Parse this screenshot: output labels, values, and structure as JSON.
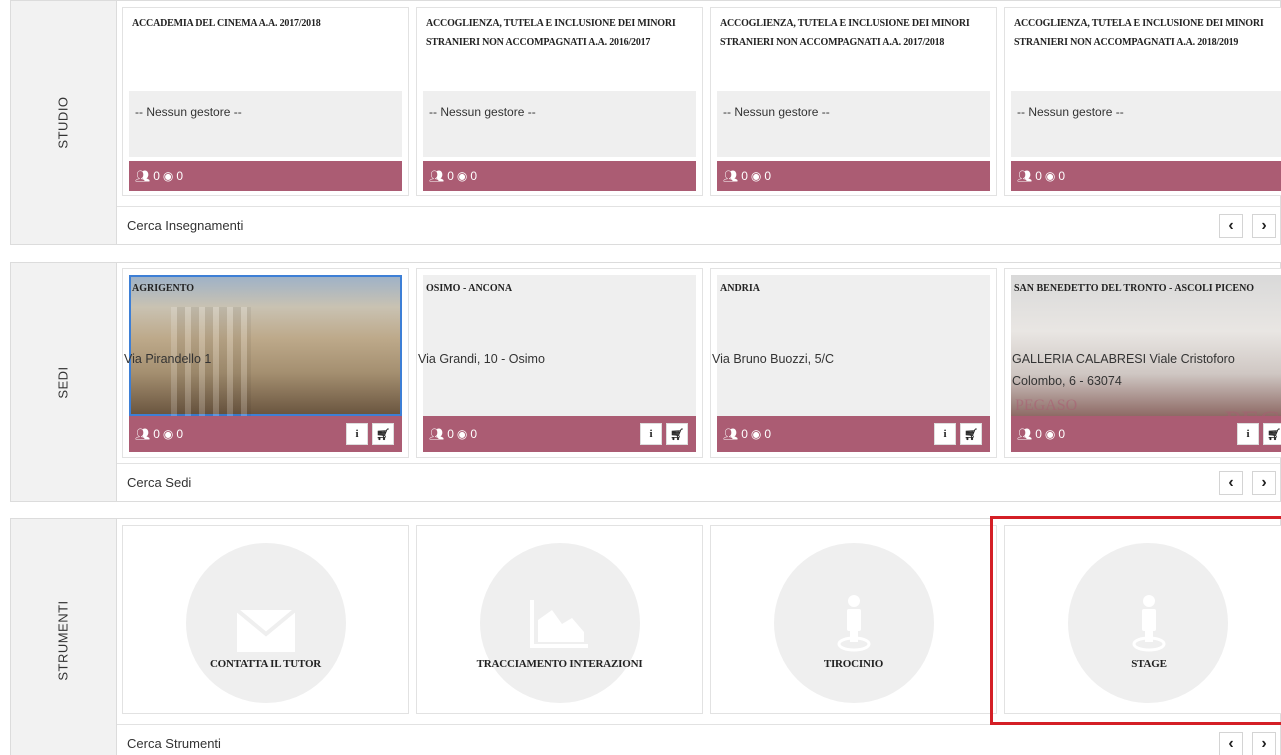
{
  "studio": {
    "label": "STUDIO",
    "cards": [
      {
        "title": "ACCADEMIA DEL CINEMA A.A. 2017/2018",
        "gestore": "-- Nessun gestore --",
        "groups": "0",
        "users": "0"
      },
      {
        "title": "ACCOGLIENZA, TUTELA E INCLUSIONE DEI MINORI STRANIERI NON ACCOMPAGNATI A.A. 2016/2017",
        "gestore": "-- Nessun gestore --",
        "groups": "0",
        "users": "0"
      },
      {
        "title": "ACCOGLIENZA, TUTELA E INCLUSIONE DEI MINORI STRANIERI NON ACCOMPAGNATI A.A. 2017/2018",
        "gestore": "-- Nessun gestore --",
        "groups": "0",
        "users": "0"
      },
      {
        "title": "ACCOGLIENZA, TUTELA E INCLUSIONE DEI MINORI STRANIERI NON ACCOMPAGNATI A.A. 2018/2019",
        "gestore": "-- Nessun gestore --",
        "groups": "0",
        "users": "0"
      }
    ],
    "search_label": "Cerca Insegnamenti"
  },
  "sedi": {
    "label": "SEDI",
    "cards": [
      {
        "title": "AGRIGENTO",
        "address": "Via Pirandello 1",
        "groups": "0",
        "users": "0"
      },
      {
        "title": "OSIMO - ANCONA",
        "address": "Via Grandi, 10 - Osimo",
        "groups": "0",
        "users": "0"
      },
      {
        "title": "ANDRIA",
        "address": "Via Bruno Buozzi, 5/C",
        "groups": "0",
        "users": "0"
      },
      {
        "title": "SAN BENEDETTO DEL TRONTO - ASCOLI PICENO",
        "address": "GALLERIA CALABRESI Viale Cristoforo Colombo, 6 - 63074",
        "groups": "0",
        "users": "0",
        "watermark_1": "PEGASO",
        "watermark_2": "PEG"
      }
    ],
    "info_glyph": "i",
    "search_label": "Cerca Sedi"
  },
  "strumenti": {
    "label": "STRUMENTI",
    "cards": [
      {
        "label": "CONTATTA IL TUTOR",
        "icon": "envelope-icon"
      },
      {
        "label": "TRACCIAMENTO INTERAZIONI",
        "icon": "area-chart-icon"
      },
      {
        "label": "TIROCINIO",
        "icon": "person-pin-icon"
      },
      {
        "label": "STAGE",
        "icon": "person-pin-icon"
      }
    ],
    "search_label": "Cerca Strumenti"
  },
  "nav": {
    "prev": "‹",
    "next": "›"
  },
  "colors": {
    "accent": "#ab5c73",
    "highlight": "#d41f26",
    "panel": "#efefef"
  }
}
